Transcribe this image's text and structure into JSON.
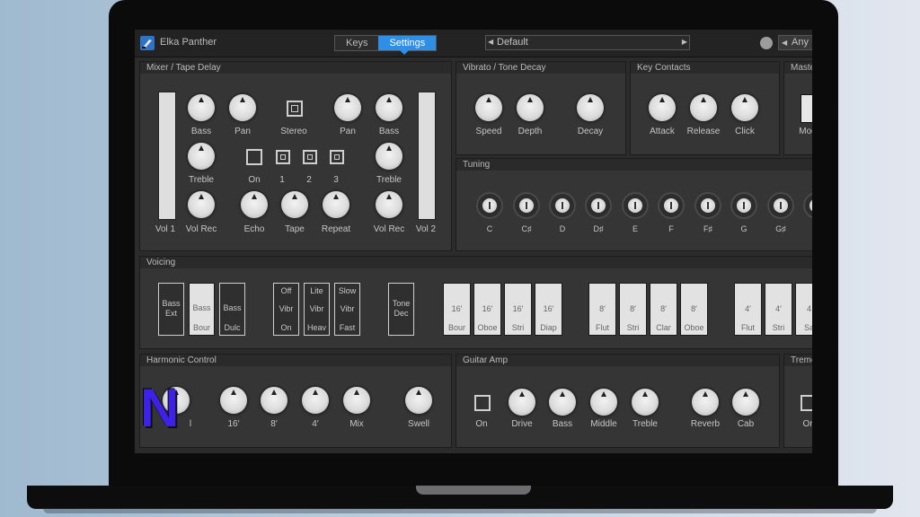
{
  "app": {
    "name": "Elka Panther"
  },
  "tabs": [
    {
      "label": "Keys"
    },
    {
      "label": "Settings"
    }
  ],
  "preset": {
    "name": "Default"
  },
  "midi": {
    "select": "Any"
  },
  "panels": {
    "mixer": {
      "title": "Mixer / Tape Delay",
      "labels": {
        "bass_l": "Bass",
        "pan_l": "Pan",
        "stereo": "Stereo",
        "pan_r": "Pan",
        "bass_r": "Bass",
        "treble_l": "Treble",
        "on": "On",
        "h1": "1",
        "h2": "2",
        "h3": "3",
        "treble_r": "Treble",
        "vol1": "Vol 1",
        "volrec_l": "Vol Rec",
        "echo": "Echo",
        "tape": "Tape",
        "repeat": "Repeat",
        "volrec_r": "Vol Rec",
        "vol2": "Vol 2"
      }
    },
    "vibrato": {
      "title": "Vibrato / Tone Decay",
      "labels": {
        "speed": "Speed",
        "depth": "Depth",
        "decay": "Decay"
      }
    },
    "key_contacts": {
      "title": "Key Contacts",
      "labels": {
        "attack": "Attack",
        "release": "Release",
        "click": "Click"
      }
    },
    "master": {
      "title": "Maste",
      "labels": {
        "mode": "Mod"
      }
    },
    "tuning": {
      "title": "Tuning",
      "notes": [
        "C",
        "C♯",
        "D",
        "D♯",
        "E",
        "F",
        "F♯",
        "G",
        "G♯"
      ]
    },
    "voicing": {
      "title": "Voicing",
      "bass_tabs": [
        {
          "top": "Bass",
          "bottom": "Ext"
        },
        {
          "top": "Bass",
          "bottom": "Bour"
        },
        {
          "top": "Bass",
          "bottom": "Dulc"
        }
      ],
      "vibr_tabs": [
        {
          "top": "Off",
          "mid": "Vibr",
          "bottom": "On"
        },
        {
          "top": "Lite",
          "mid": "Vibr",
          "bottom": "Heav"
        },
        {
          "top": "Slow",
          "mid": "Vibr",
          "bottom": "Fast"
        }
      ],
      "tone_dec": {
        "top": "Tone",
        "bottom": "Dec"
      },
      "feet16": [
        {
          "top": "16′",
          "bottom": "Bour"
        },
        {
          "top": "16′",
          "bottom": "Oboe"
        },
        {
          "top": "16′",
          "bottom": "Stri"
        },
        {
          "top": "16′",
          "bottom": "Diap"
        }
      ],
      "feet8": [
        {
          "top": "8′",
          "bottom": "Flut"
        },
        {
          "top": "8′",
          "bottom": "Stri"
        },
        {
          "top": "8′",
          "bottom": "Clar"
        },
        {
          "top": "8′",
          "bottom": "Oboe"
        }
      ],
      "feet4": [
        {
          "top": "4′",
          "bottom": "Flut"
        },
        {
          "top": "4′",
          "bottom": "Stri"
        },
        {
          "top": "4",
          "bottom": "Sa"
        }
      ]
    },
    "harmonic": {
      "title": "Harmonic Control",
      "labels": {
        "partial": "l",
        "f16": "16′",
        "f8": "8′",
        "f4": "4′",
        "mix": "Mix",
        "swell": "Swell"
      }
    },
    "guitar": {
      "title": "Guitar Amp",
      "labels": {
        "on": "On",
        "drive": "Drive",
        "bass": "Bass",
        "middle": "Middle",
        "treble": "Treble",
        "reverb": "Reverb",
        "cab": "Cab"
      }
    },
    "tremolo": {
      "title": "Tremo",
      "labels": {
        "on": "Or"
      }
    }
  },
  "overlay_logo": {
    "letter": "N",
    "color": "#3d22e6"
  },
  "colors": {
    "accent": "#2f8ee6",
    "panel": "#353536",
    "background": "#2b2b2c"
  }
}
